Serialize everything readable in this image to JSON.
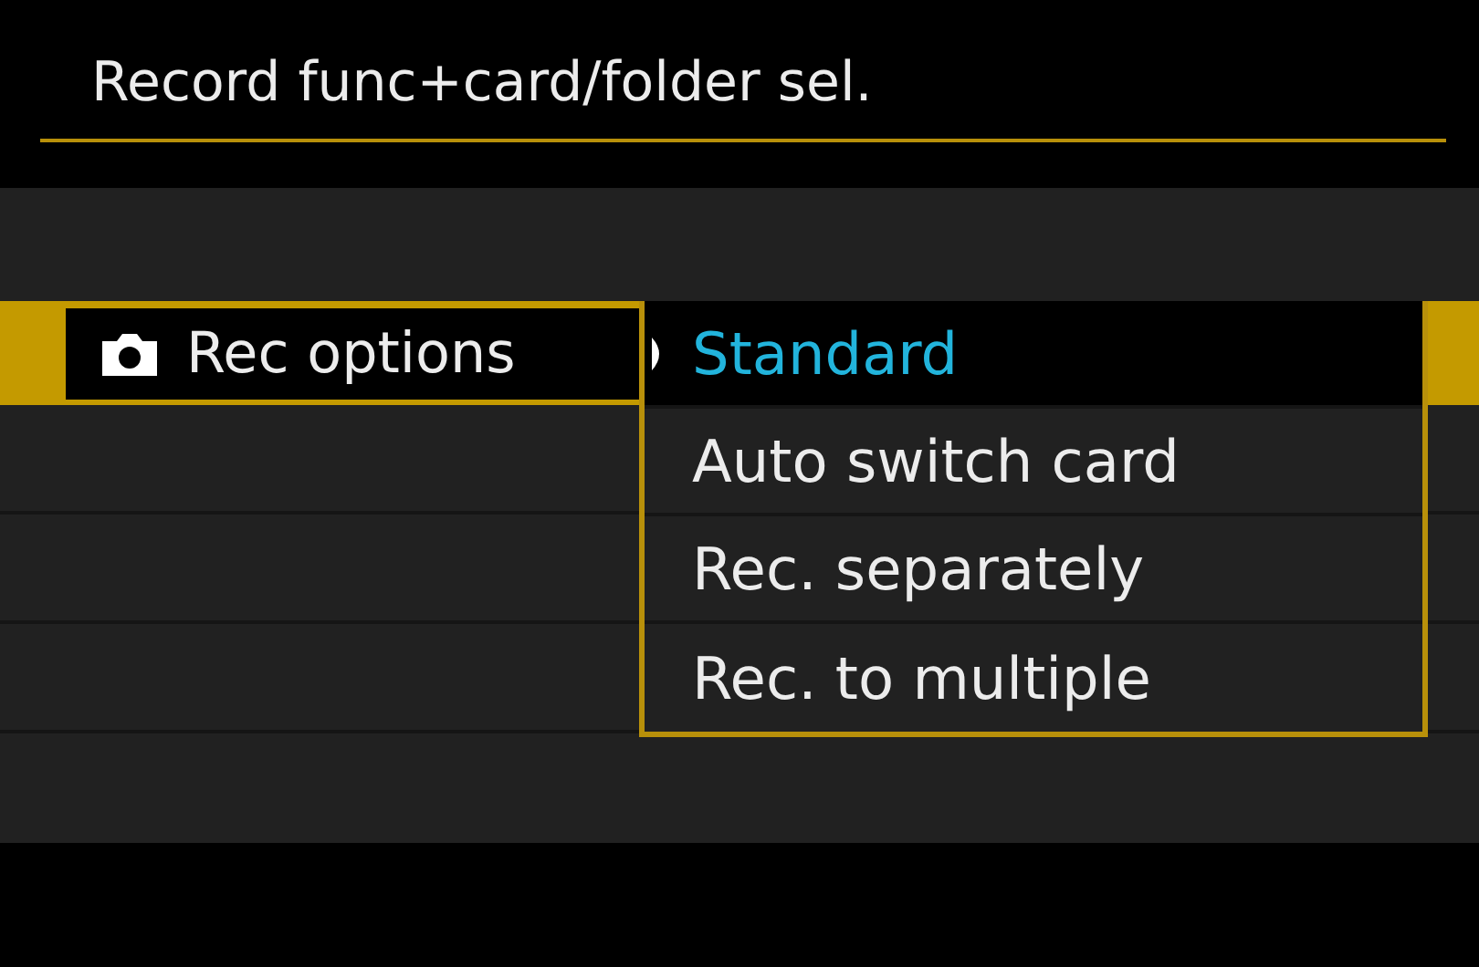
{
  "title": "Record func+card/folder sel.",
  "menu_items": [
    {
      "label": "Rec options",
      "selected": true
    }
  ],
  "options": [
    {
      "label": "Standard",
      "selected": true
    },
    {
      "label": "Auto switch card",
      "selected": false
    },
    {
      "label": "Rec. separately",
      "selected": false
    },
    {
      "label": "Rec. to multiple",
      "selected": false
    }
  ]
}
